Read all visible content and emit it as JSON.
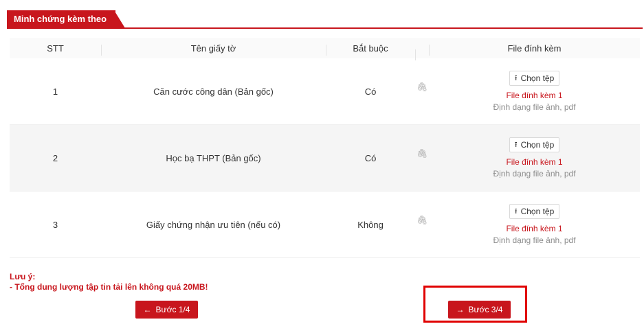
{
  "section": {
    "title": "Minh chứng kèm theo"
  },
  "table": {
    "headers": [
      "STT",
      "Tên giấy tờ",
      "Bắt buộc",
      "",
      "File đính kèm"
    ],
    "rows": [
      {
        "stt": "1",
        "name": "Căn cước công dân (Bản gốc)",
        "required": "Có",
        "button": "Chọn tệp",
        "file": "File đính kèm 1",
        "format": "Định dạng file ảnh, pdf"
      },
      {
        "stt": "2",
        "name": "Học bạ THPT (Bản gốc)",
        "required": "Có",
        "button": "Chọn tệp",
        "file": "File đính kèm 1",
        "format": "Định dạng file ảnh, pdf"
      },
      {
        "stt": "3",
        "name": "Giấy chứng nhận ưu tiên (nếu có)",
        "required": "Không",
        "button": "Chọn tệp",
        "file": "File đính kèm 1",
        "format": "Định dạng file ảnh, pdf"
      }
    ]
  },
  "note": {
    "title": "Lưu ý:",
    "line": "- Tổng dung lượng tập tin tải lên không quá 20MB!"
  },
  "buttons": {
    "prev": "Bước 1/4",
    "next": "Bước 3/4"
  },
  "icons": {
    "upload": "upload-icon",
    "attachment": "paperclip-icon",
    "arrow_left": "arrow-left-icon",
    "arrow_right": "arrow-right-icon"
  },
  "colors": {
    "accent": "#c8161d",
    "highlight": "#e00000"
  }
}
